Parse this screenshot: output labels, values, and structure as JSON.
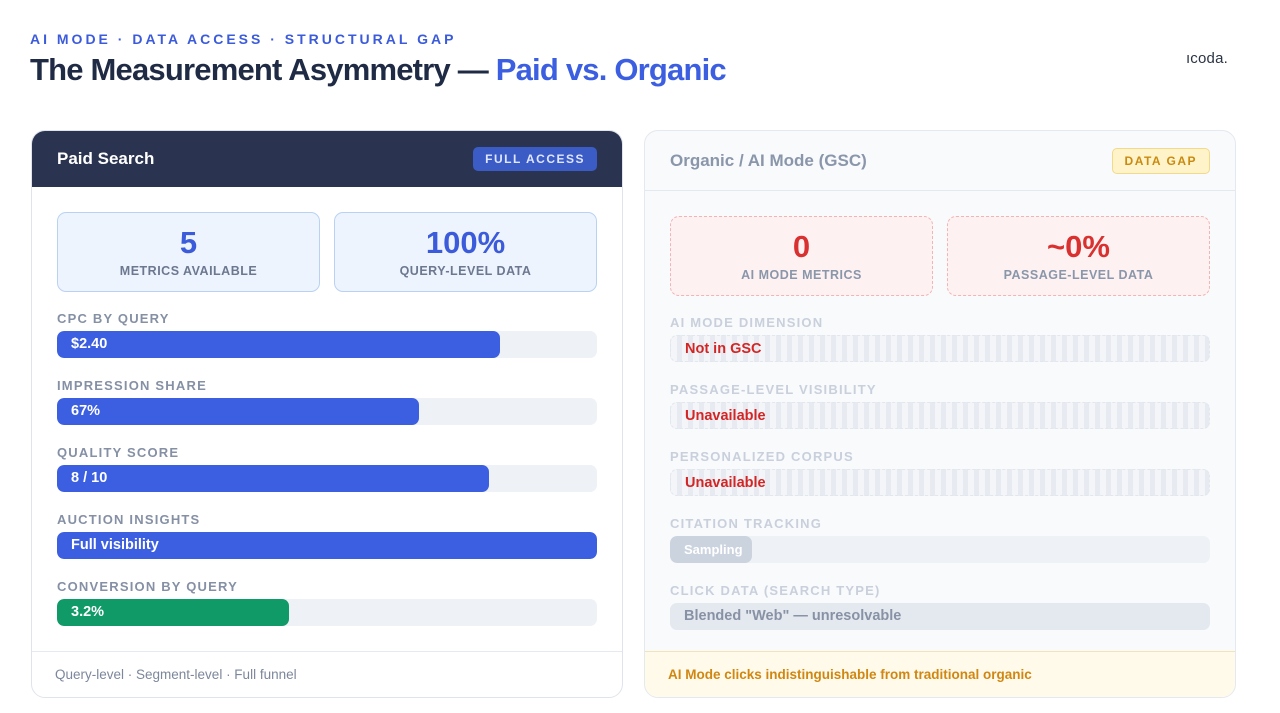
{
  "header": {
    "eyebrow": "AI MODE · DATA ACCESS · STRUCTURAL GAP",
    "title_main": "The Measurement Asymmetry — ",
    "title_accent": "Paid vs. Organic",
    "brand": "ıcoda."
  },
  "paid": {
    "title": "Paid Search",
    "badge": "FULL ACCESS",
    "stats": [
      {
        "value": "5",
        "label": "METRICS AVAILABLE"
      },
      {
        "value": "100%",
        "label": "QUERY-LEVEL DATA"
      }
    ],
    "metrics": [
      {
        "label": "CPC BY QUERY",
        "value": "$2.40",
        "fill_fraction": 0.82
      },
      {
        "label": "IMPRESSION SHARE",
        "value": "67%",
        "fill_fraction": 0.67
      },
      {
        "label": "QUALITY SCORE",
        "value": "8 / 10",
        "fill_fraction": 0.8
      },
      {
        "label": "AUCTION INSIGHTS",
        "value": "Full visibility",
        "fill_fraction": 1.0
      },
      {
        "label": "CONVERSION BY QUERY",
        "value": "3.2%",
        "fill_fraction": 0.43
      }
    ],
    "footer": "Query-level · Segment-level · Full funnel",
    "colors": {
      "bar": "#3b5fe0",
      "conversion_bar": "#0f9a67"
    }
  },
  "organic": {
    "title": "Organic / AI Mode (GSC)",
    "badge": "DATA GAP",
    "stats": [
      {
        "value": "0",
        "label": "AI MODE METRICS"
      },
      {
        "value": "~0%",
        "label": "PASSAGE-LEVEL DATA"
      }
    ],
    "metrics": [
      {
        "label": "AI MODE DIMENSION",
        "value": "Not in GSC"
      },
      {
        "label": "PASSAGE-LEVEL VISIBILITY",
        "value": "Unavailable"
      },
      {
        "label": "PERSONALIZED CORPUS",
        "value": "Unavailable"
      },
      {
        "label": "CITATION TRACKING",
        "value": "Sampling"
      },
      {
        "label": "CLICK DATA (SEARCH TYPE)",
        "value": "Blended \"Web\" — unresolvable"
      }
    ],
    "footer": "AI Mode clicks indistinguishable from traditional organic",
    "colors": {
      "unavailable_text": "#d42525",
      "gap_badge": "#c98a10"
    }
  }
}
